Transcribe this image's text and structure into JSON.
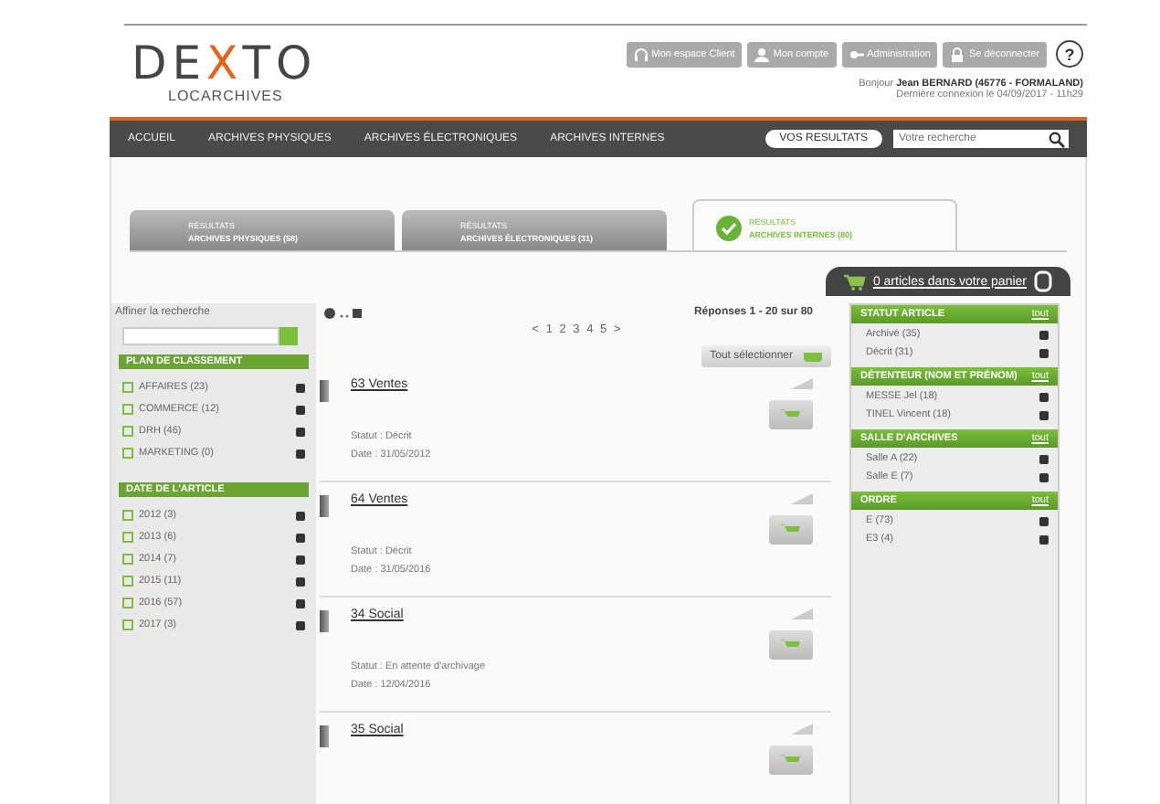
{
  "logo": {
    "parts": [
      {
        "text": "DE",
        "accent": false
      },
      {
        "text": "X",
        "accent": true
      },
      {
        "text": "TO",
        "accent": false
      }
    ],
    "subtitle": "LOCARCHIVES"
  },
  "top_buttons": [
    {
      "label": "Mon espace Client"
    },
    {
      "label": "Mon compte"
    },
    {
      "label": "Administration"
    },
    {
      "label": "Se déconnecter"
    }
  ],
  "help": "?",
  "greeting": "Bonjour **Jean BERNARD (46776 - FORMALAND)**",
  "last_login": "Dernière connexion le 04/09/2017 - 11h29",
  "nav": [
    "ACCUEIL",
    "ARCHIVES PHYSIQUES",
    "ARCHIVES ÉLECTRONIQUES",
    "ARCHIVES INTERNES"
  ],
  "results_button": "VOS RESULTATS",
  "search": {
    "placeholder": "Votre recherche"
  },
  "tabs": [
    {
      "kicker": "RÉSULTATS",
      "label": "ARCHIVES PHYSIQUES (58)",
      "selected": false
    },
    {
      "kicker": "RÉSULTATS",
      "label": "ARCHIVES ÉLECTRONIQUES (31)",
      "selected": false
    },
    {
      "kicker": "RÉSULTATS",
      "label": "ARCHIVES INTERNES (80)",
      "selected": true
    }
  ],
  "cart": "0 articles dans votre panier",
  "refine": {
    "title": "Affiner la recherche",
    "groups": [
      {
        "title": "PLAN DE CLASSEMENT",
        "items": [
          "AFFAIRES (23)",
          "COMMERCE (12)",
          "DRH (46)",
          "MARKETING (0)"
        ]
      },
      {
        "title": "DATE DE L'ARTICLE",
        "items": [
          "2012 (3)",
          "2013 (6)",
          "2014 (7)",
          "2015 (11)",
          "2016 (57)",
          "2017 (3)"
        ]
      }
    ]
  },
  "answers": "Réponses 1 - 20 sur 80",
  "pages": "< 1 2 3 4 5 >",
  "select_all": "Tout sélectionner",
  "results": [
    {
      "title": "63 Ventes",
      "status": "Statut : Décrit",
      "date": "Date : 31/05/2012"
    },
    {
      "title": "64 Ventes",
      "status": "Statut : Décrit",
      "date": "Date : 31/05/2016"
    },
    {
      "title": "34 Social",
      "status": "Statut : En attente d'archivage",
      "date": "Date : 12/04/2016"
    },
    {
      "title": "35 Social"
    }
  ],
  "facets": [
    {
      "title": "STATUT ARTICLE",
      "link": "tout",
      "items": [
        "Archivé (35)",
        "Décrit (31)"
      ]
    },
    {
      "title": "DÉTENTEUR (NOM ET PRÉNOM)",
      "link": "tout",
      "items": [
        "MESSE Jel (18)",
        "TINEL Vincent (18)"
      ]
    },
    {
      "title": "SALLE D'ARCHIVES",
      "link": "tout",
      "items": [
        "Salle A (22)",
        "Salle E (7)"
      ]
    },
    {
      "title": "ORDRE",
      "link": "tout",
      "items": [
        "E (73)",
        "E3 (4)"
      ]
    }
  ]
}
